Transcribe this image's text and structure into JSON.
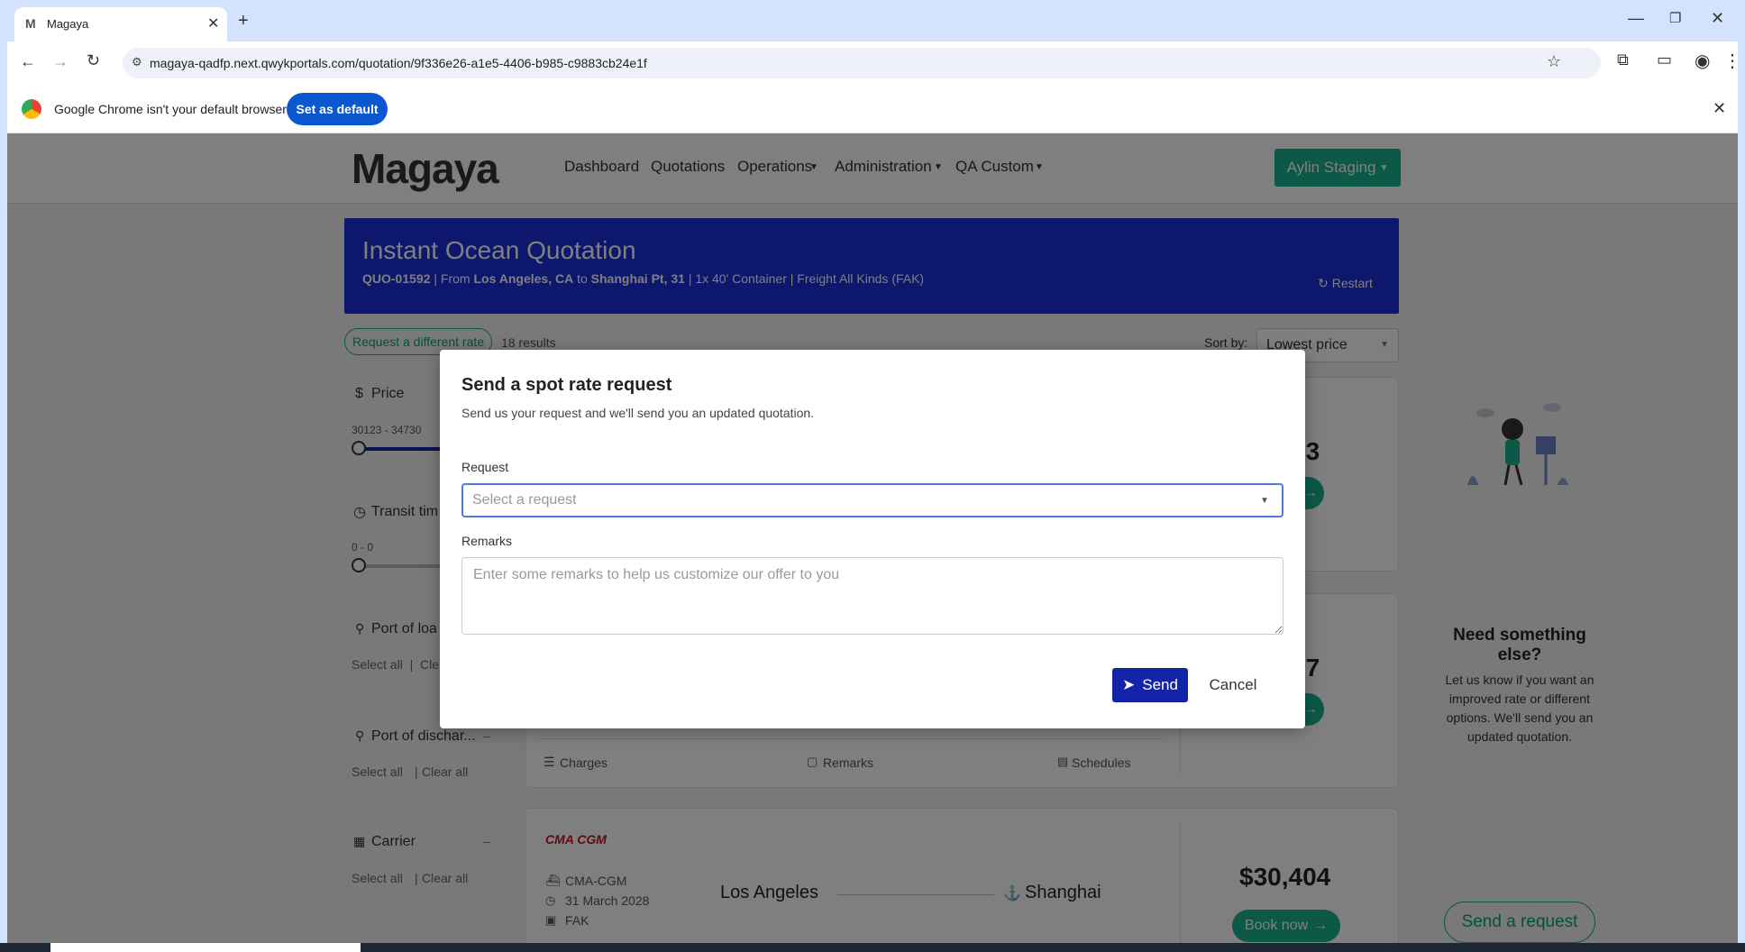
{
  "browser": {
    "tab_title": "Magaya",
    "url": "magaya-qadfp.next.qwykportals.com/quotation/9f336e26-a1e5-4406-b985-c9883cb24e1f",
    "infobar_text": "Google Chrome isn't your default browser",
    "set_default_label": "Set as default"
  },
  "nav": {
    "logo": "Magaya",
    "links": [
      "Dashboard",
      "Quotations",
      "Operations",
      "Administration",
      "QA Custom"
    ],
    "account_label": "Aylin Staging"
  },
  "hero": {
    "title": "Instant Ocean Quotation",
    "quote_id": "QUO-01592",
    "from_prefix": "| From",
    "origin": "Los Angeles, CA",
    "to_word": "to",
    "destination": "Shanghai Pt, 31",
    "details": "|  1x 40' Container | Freight All Kinds (FAK)",
    "restart_label": "Restart"
  },
  "results": {
    "request_different_rate": "Request a different rate",
    "count": "18 results",
    "sort_label": "Sort by:",
    "sort_value": "Lowest price"
  },
  "filters": {
    "price_label": "Price",
    "price_range": "30123 - 34730",
    "transit_label": "Transit tim",
    "transit_range": "0 - 0",
    "pol_label": "Port of loa",
    "pol_links": "Select all  |  Cle",
    "pod_label": "Port of dischar...",
    "pod_links_select": "Select all",
    "pod_links_clear": "Clear all",
    "carrier_label": "Carrier",
    "carrier_links_select": "Select all",
    "carrier_links_clear": "Clear all",
    "collapse_symbol": "–"
  },
  "cards": {
    "price1_partial": "23",
    "price2_partial": "27",
    "tab_charges": "Charges",
    "tab_remarks": "Remarks",
    "tab_schedules": "Schedules",
    "carrier_logo": "CMA CGM",
    "carrier_name": "CMA-CGM",
    "date": "31 March 2028",
    "commodity": "FAK",
    "origin_city": "Los Angeles",
    "dest_city": "Shanghai",
    "price3": "$30,404",
    "book_now": "Book now"
  },
  "help": {
    "title": "Need something else?",
    "body": "Let us know if you want an improved rate or different options. We'll send you an updated quotation.",
    "send_request": "Send a request"
  },
  "modal": {
    "title": "Send a spot rate request",
    "subtitle": "Send us your request and we'll send you an updated quotation.",
    "request_label": "Request",
    "request_placeholder": "Select a request",
    "remarks_label": "Remarks",
    "remarks_placeholder": "Enter some remarks to help us customize our offer to you",
    "send_label": "Send",
    "cancel_label": "Cancel"
  },
  "colors": {
    "hero_bg": "#1a2fd6",
    "accent_green": "#19b28f",
    "send_btn": "#1424a8"
  }
}
